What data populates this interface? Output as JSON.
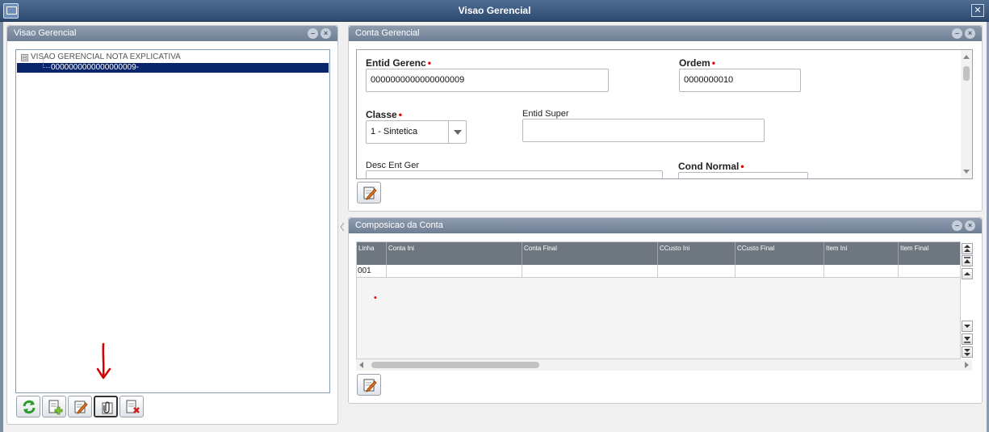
{
  "window": {
    "title": "Visao Gerencial",
    "close_label": "✕"
  },
  "left_panel": {
    "title": "Visao Gerencial",
    "tree": {
      "root": "VISAO GERENCIAL NOTA EXPLICATIVA",
      "root_expander": "⊟",
      "child": "0000000000000000009-"
    },
    "toolbar": [
      "refresh-icon",
      "add-document-icon",
      "edit-icon",
      "attach-icon",
      "delete-document-icon"
    ],
    "annotation_color": "#d40000"
  },
  "conta_panel": {
    "title": "Conta Gerencial",
    "fields": {
      "entid_gerenc": {
        "label": "Entid Gerenc",
        "value": "0000000000000000009"
      },
      "ordem": {
        "label": "Ordem",
        "value": "0000000010"
      },
      "classe": {
        "label": "Classe",
        "value": "1 - Sintetica"
      },
      "entid_super": {
        "label": "Entid Super",
        "value": ""
      },
      "desc_ent_ger": {
        "label": "Desc Ent Ger",
        "value": ""
      },
      "cond_normal": {
        "label": "Cond Normal",
        "value": ""
      }
    },
    "required_mark": "•"
  },
  "composicao_panel": {
    "title": "Composicao da Conta",
    "columns": [
      "Linha",
      "Conta Ini",
      "Conta Final",
      "CCusto Ini",
      "CCusto Final",
      "Item Ini",
      "Item Final"
    ],
    "rows": [
      [
        "001",
        "",
        "",
        "",
        "",
        "",
        ""
      ]
    ],
    "marker": "•"
  },
  "header_buttons": {
    "minimize": "–",
    "close": "×"
  },
  "colors": {
    "titlebar": "#2c4a70",
    "panel_header": "#7a889b",
    "selection": "#0a246a",
    "required": "#d00000"
  }
}
